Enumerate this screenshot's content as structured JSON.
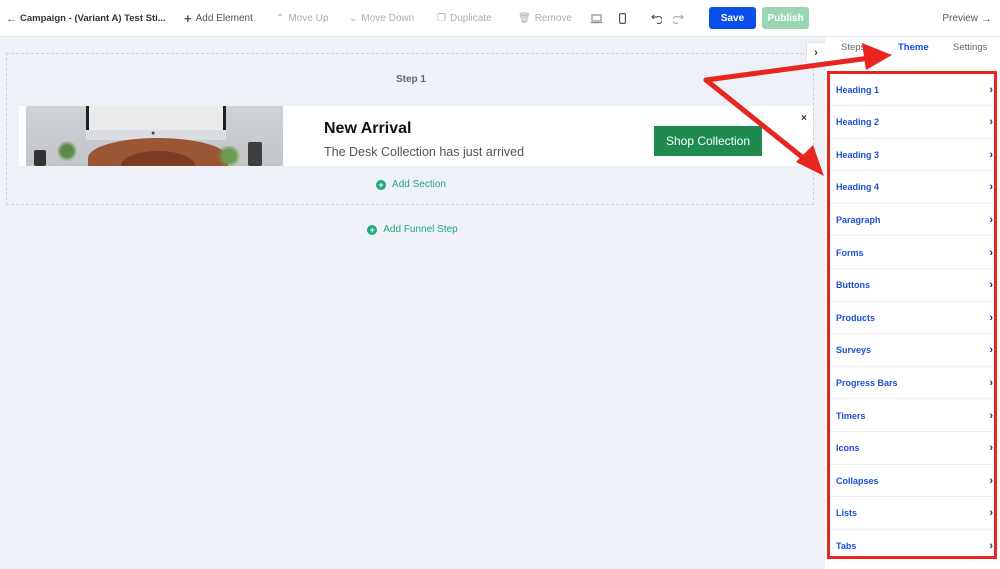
{
  "toolbar": {
    "back_label": "Campaign - (Variant A) Test Sti...",
    "add_element": "Add Element",
    "move_up": "Move Up",
    "move_down": "Move Down",
    "duplicate": "Duplicate",
    "remove": "Remove",
    "save": "Save",
    "publish": "Publish",
    "preview": "Preview"
  },
  "canvas": {
    "step_title": "Step 1",
    "banner": {
      "title": "New Arrival",
      "subtitle": "The Desk Collection has just arrived",
      "button": "Shop Collection",
      "close": "×"
    },
    "add_section": "Add Section",
    "add_funnel_step": "Add Funnel Step"
  },
  "panel": {
    "tabs": [
      "Steps",
      "Theme",
      "Settings"
    ],
    "active_tab": "Theme",
    "items": [
      "Heading 1",
      "Heading 2",
      "Heading 3",
      "Heading 4",
      "Paragraph",
      "Forms",
      "Buttons",
      "Products",
      "Surveys",
      "Progress Bars",
      "Timers",
      "Icons",
      "Collapses",
      "Lists",
      "Tabs"
    ]
  },
  "colors": {
    "accent_blue": "#0b50e8",
    "publish_green": "#9ad6b4",
    "shop_green": "#1e8a4e",
    "annotation_red": "#e8261f"
  }
}
